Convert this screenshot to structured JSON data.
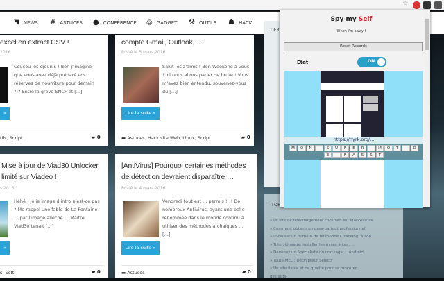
{
  "nav": {
    "items": [
      {
        "label": "NEWS",
        "icon": "rss-icon"
      },
      {
        "label": "ASTUCES",
        "icon": "tictactoe-icon"
      },
      {
        "label": "CONFÉRENCE",
        "icon": "group-icon"
      },
      {
        "label": "GADGET",
        "icon": "gadget-icon"
      },
      {
        "label": "OUTILS",
        "icon": "hammer-icon"
      },
      {
        "label": "HACK",
        "icon": "mask-icon"
      }
    ]
  },
  "cards": [
    {
      "title": "excel en extract CSV !",
      "date": "2016",
      "excerpt": "Coucou les djeun's ! Bon j'imagine que vous avez déjà préparé vos réserves de nourriture pour demain ?!? Entre la grève SNCF et [...]",
      "button": "»",
      "tags": "tils, Script",
      "comments": "0"
    },
    {
      "title": "compte Gmail, Outlook, ….",
      "date": "Posté le 5 mars 2016",
      "excerpt": "Salut les z'amis ! Bon Weekend à vous ! Ici nous allons parler de brute ! Vous m'avez bien entendu, souvenez-vous du […]",
      "button": "Lire la suite »",
      "tags": "Astuces, Hack site Web, Linux, Script",
      "comments": "0"
    },
    {
      "title": "Mise à jour de Viad30 Unlocker",
      "title2": "limité sur Viadeo !",
      "date": "s 2016",
      "excerpt": "Héhé ! jolie image d'intro n'est-ce pas ? Me rappel une fable de La Fontaine … par l'image alléché … Maitre Viad30 tenait […]",
      "button": "»",
      "tags": "s, Soft",
      "comments": "0"
    },
    {
      "title": "[AntiVirus] Pourquoi certaines méthodes",
      "title2": "de détection devraient disparaître …",
      "date": "Posté le 4 mars 2016",
      "excerpt": "Vendredi tout est … permis !!!! De nombreux Antivirus, ayant une belle renommée dans le monde continu à utiliser des méthodes archaïques … […]",
      "button": "Lire la suite »",
      "tags": "Astuces",
      "comments": "0"
    }
  ],
  "sidebar": {
    "top_label": "DER",
    "heading": "TOP",
    "items": [
      "Le site de téléchargement codsbien est inaccessible",
      "Comment obtenir un pass-partout professionnel",
      "Localiser un numéro de téléphone ( tracking) à son",
      "Tuto : Lineage, installer les mises à jour, ...",
      "Devenez un Spécialiste du crackage ... Android",
      "Toute MEL : Décrypteur Selectr",
      "Un site fiable et de qualité pour se procurer",
      "des appli"
    ]
  },
  "popup": {
    "title_prefix": "Spy my ",
    "title_accent": "Self",
    "subtitle": "When i'm away !",
    "reset_button": "Reset Records",
    "state_label": "Etat",
    "toggle_label": "ON",
    "toggle_on": true,
    "link": "https://nyrk.org/...",
    "keys": [
      "M",
      "O",
      "N",
      "",
      "S",
      "U",
      "P",
      "E",
      "R",
      "",
      "M",
      "O",
      "T",
      "",
      "D",
      "E",
      "",
      "P",
      "A",
      "S",
      "S",
      "T"
    ],
    "accent_color": "#e0202e"
  }
}
